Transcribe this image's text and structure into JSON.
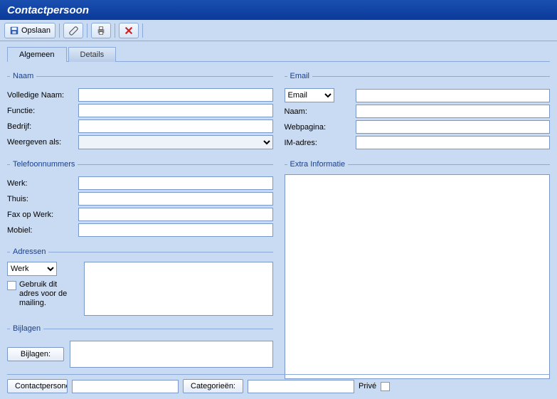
{
  "title": "Contactpersoon",
  "toolbar": {
    "save_label": "Opslaan"
  },
  "tabs": {
    "general": "Algemeen",
    "details": "Details"
  },
  "naam": {
    "legend": "Naam",
    "volledige": "Volledige Naam:",
    "functie": "Functie:",
    "bedrijf": "Bedrijf:",
    "weergeven": "Weergeven als:"
  },
  "tel": {
    "legend": "Telefoonnummers",
    "werk": "Werk:",
    "thuis": "Thuis:",
    "fax": "Fax op Werk:",
    "mobiel": "Mobiel:"
  },
  "adres": {
    "legend": "Adressen",
    "type": "Werk",
    "check": "Gebruik dit adres voor de mailing."
  },
  "bijlagen": {
    "legend": "Bijlagen",
    "button": "Bijlagen:"
  },
  "email": {
    "legend": "Email",
    "type": "Email",
    "naam": "Naam:",
    "web": "Webpagina:",
    "im": "IM-adres:"
  },
  "extra": {
    "legend": "Extra Informatie"
  },
  "bottom": {
    "contact_btn": "Contactpersonen",
    "cat_btn": "Categorieën:",
    "prive": "Privé"
  }
}
